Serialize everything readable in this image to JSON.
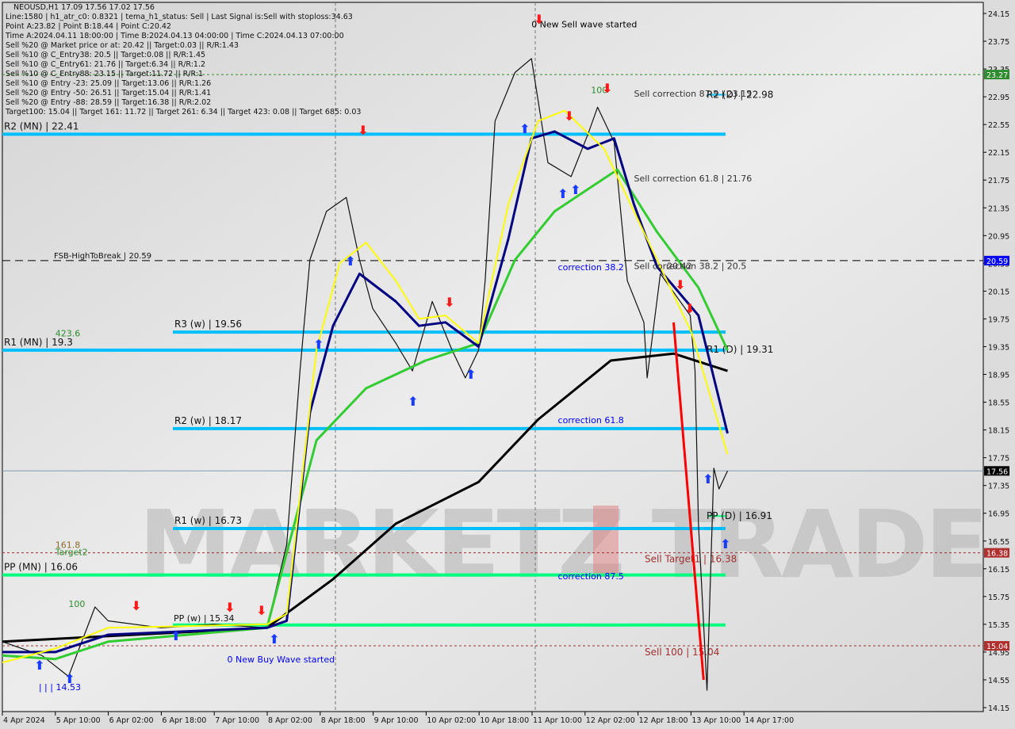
{
  "header": {
    "symbol_line": "NEOUSD,H1  17.09 17.56 17.02 17.56",
    "info_lines": [
      "Line:1580 | h1_atr_c0: 0.8321 | tema_h1_status: Sell | Last Signal is:Sell with stoploss:34.63",
      "Point A:23.82 | Point B:18.44 | Point C:20.42",
      "Time A:2024.04.11 18:00:00 | Time B:2024.04.13 04:00:00 | Time C:2024.04.13 07:00:00",
      "Sell %20 @ Market price or at: 20.42 || Target:0.03 || R/R:1.43",
      "Sell %10 @ C_Entry38: 20.5 || Target:0.08 || R/R:1.45",
      "Sell %10 @ C_Entry61: 21.76 || Target:6.34 || R/R:1.2",
      "Sell %10 @ C_Entry88: 23.15 || Target:11.72 || R/R:1",
      "Sell %10 @ Entry -23: 25.09 || Target:13.06 || R/R:1.26",
      "Sell %20 @ Entry -50: 26.51 || Target:15.04 || R/R:1.41",
      "Sell %20 @ Entry -88: 28.59 || Target:16.38 || R/R:2.02",
      "Target100: 15.04 || Target 161: 11.72 || Target 261: 6.34 || Target 423: 0.08 || Target 685: 0.03"
    ]
  },
  "watermark": "MARKETZ TRADE",
  "chart_data": {
    "type": "line",
    "title": "NEOUSD,H1",
    "ylim": [
      14.15,
      24.15
    ],
    "y_ticks": [
      "24.15",
      "23.75",
      "23.35",
      "22.95",
      "22.55",
      "22.15",
      "21.75",
      "21.35",
      "20.95",
      "20.55",
      "20.15",
      "19.75",
      "19.35",
      "18.95",
      "18.55",
      "18.15",
      "17.75",
      "17.35",
      "16.95",
      "16.55",
      "16.15",
      "15.75",
      "15.35",
      "14.95",
      "14.55",
      "14.15"
    ],
    "x_ticks": [
      "4 Apr 2024",
      "5 Apr 10:00",
      "6 Apr 02:00",
      "6 Apr 18:00",
      "7 Apr 10:00",
      "8 Apr 02:00",
      "8 Apr 18:00",
      "9 Apr 10:00",
      "10 Apr 02:00",
      "10 Apr 18:00",
      "11 Apr 10:00",
      "12 Apr 02:00",
      "12 Apr 18:00",
      "13 Apr 10:00",
      "14 Apr 17:00"
    ],
    "price_tags": [
      {
        "value": "23.27",
        "color": "#2e8b2e"
      },
      {
        "value": "20.59",
        "color": "#0000ff"
      },
      {
        "value": "17.56",
        "color": "#000000"
      },
      {
        "value": "16.38",
        "color": "#b03030"
      },
      {
        "value": "15.04",
        "color": "#b03030"
      }
    ],
    "series": [
      {
        "color": "#111111",
        "points": [
          [
            "4 Apr 18:00",
            15.1
          ],
          [
            "5 Apr 06:00",
            14.9
          ],
          [
            "5 Apr 14:00",
            14.6
          ],
          [
            "5 Apr 22:00",
            15.6
          ],
          [
            "6 Apr 02:00",
            15.4
          ],
          [
            "6 Apr 18:00",
            15.3
          ],
          [
            "7 Apr 10:00",
            15.35
          ],
          [
            "8 Apr 02:00",
            15.3
          ],
          [
            "8 Apr 08:00",
            16.5
          ],
          [
            "8 Apr 12:00",
            19.0
          ],
          [
            "8 Apr 15:00",
            20.6
          ],
          [
            "8 Apr 20:00",
            21.3
          ],
          [
            "9 Apr 02:00",
            21.5
          ],
          [
            "9 Apr 06:00",
            20.6
          ],
          [
            "9 Apr 10:00",
            19.9
          ],
          [
            "9 Apr 17:00",
            19.4
          ],
          [
            "9 Apr 22:00",
            19.0
          ],
          [
            "10 Apr 04:00",
            20.0
          ],
          [
            "10 Apr 10:00",
            19.3
          ],
          [
            "10 Apr 14:00",
            18.9
          ],
          [
            "10 Apr 18:00",
            19.3
          ],
          [
            "10 Apr 20:00",
            20.3
          ],
          [
            "10 Apr 23:00",
            22.6
          ],
          [
            "11 Apr 05:00",
            23.3
          ],
          [
            "11 Apr 10:00",
            23.5
          ],
          [
            "11 Apr 15:00",
            22.0
          ],
          [
            "11 Apr 22:00",
            21.8
          ],
          [
            "12 Apr 03:00",
            22.4
          ],
          [
            "12 Apr 06:00",
            22.8
          ],
          [
            "12 Apr 11:00",
            22.3
          ],
          [
            "12 Apr 15:00",
            20.3
          ],
          [
            "12 Apr 20:00",
            19.7
          ],
          [
            "12 Apr 21:00",
            18.9
          ],
          [
            "13 Apr 01:00",
            20.4
          ],
          [
            "13 Apr 10:00",
            19.8
          ],
          [
            "13 Apr 13:00",
            19.0
          ],
          [
            "13 Apr 15:00",
            16.8
          ],
          [
            "13 Apr 20:00",
            14.4
          ],
          [
            "14 Apr 00:00",
            17.6
          ],
          [
            "14 Apr 03:00",
            17.3
          ],
          [
            "14 Apr 08:00",
            17.56
          ]
        ]
      },
      {
        "color": "#000000",
        "points": [
          [
            "4 Apr 18:00",
            15.1
          ],
          [
            "8 Apr 02:00",
            15.3
          ],
          [
            "8 Apr 22:00",
            16.0
          ],
          [
            "9 Apr 17:00",
            16.8
          ],
          [
            "10 Apr 18:00",
            17.4
          ],
          [
            "11 Apr 12:00",
            18.3
          ],
          [
            "12 Apr 10:00",
            19.15
          ],
          [
            "13 Apr 05:00",
            19.25
          ],
          [
            "14 Apr 08:00",
            19.0
          ]
        ]
      },
      {
        "color": "#33cc33",
        "points": [
          [
            "4 Apr 18:00",
            14.9
          ],
          [
            "5 Apr 10:00",
            14.85
          ],
          [
            "6 Apr 02:00",
            15.1
          ],
          [
            "8 Apr 02:00",
            15.3
          ],
          [
            "8 Apr 17:00",
            18.0
          ],
          [
            "9 Apr 08:00",
            18.75
          ],
          [
            "10 Apr 02:00",
            19.15
          ],
          [
            "10 Apr 18:00",
            19.4
          ],
          [
            "11 Apr 05:00",
            20.6
          ],
          [
            "11 Apr 17:00",
            21.3
          ],
          [
            "12 Apr 12:00",
            21.9
          ],
          [
            "13 Apr 00:00",
            21.0
          ],
          [
            "13 Apr 15:00",
            20.2
          ],
          [
            "14 Apr 08:00",
            19.3
          ]
        ]
      },
      {
        "color": "#000080",
        "points": [
          [
            "4 Apr 18:00",
            14.95
          ],
          [
            "5 Apr 10:00",
            14.95
          ],
          [
            "6 Apr 02:00",
            15.2
          ],
          [
            "8 Apr 02:00",
            15.3
          ],
          [
            "8 Apr 08:00",
            15.4
          ],
          [
            "8 Apr 15:00",
            18.4
          ],
          [
            "8 Apr 22:00",
            19.65
          ],
          [
            "9 Apr 06:00",
            20.4
          ],
          [
            "9 Apr 17:00",
            20.0
          ],
          [
            "10 Apr 00:00",
            19.65
          ],
          [
            "10 Apr 08:00",
            19.7
          ],
          [
            "10 Apr 18:00",
            19.35
          ],
          [
            "11 Apr 03:00",
            20.9
          ],
          [
            "11 Apr 10:00",
            22.35
          ],
          [
            "11 Apr 17:00",
            22.45
          ],
          [
            "12 Apr 03:00",
            22.2
          ],
          [
            "12 Apr 11:00",
            22.35
          ],
          [
            "12 Apr 17:00",
            21.4
          ],
          [
            "13 Apr 00:00",
            20.5
          ],
          [
            "13 Apr 15:00",
            19.8
          ],
          [
            "14 Apr 08:00",
            18.1
          ]
        ]
      },
      {
        "color": "#ffff00",
        "points": [
          [
            "4 Apr 18:00",
            14.8
          ],
          [
            "5 Apr 10:00",
            15.0
          ],
          [
            "6 Apr 02:00",
            15.3
          ],
          [
            "8 Apr 02:00",
            15.35
          ],
          [
            "8 Apr 08:00",
            15.5
          ],
          [
            "8 Apr 17:00",
            19.3
          ],
          [
            "9 Apr 00:00",
            20.55
          ],
          [
            "9 Apr 08:00",
            20.85
          ],
          [
            "9 Apr 17:00",
            20.3
          ],
          [
            "10 Apr 00:00",
            19.75
          ],
          [
            "10 Apr 08:00",
            19.8
          ],
          [
            "10 Apr 18:00",
            19.4
          ],
          [
            "11 Apr 03:00",
            21.4
          ],
          [
            "11 Apr 12:00",
            22.6
          ],
          [
            "11 Apr 20:00",
            22.75
          ],
          [
            "12 Apr 08:00",
            22.2
          ],
          [
            "12 Apr 12:00",
            21.8
          ],
          [
            "12 Apr 22:00",
            20.8
          ],
          [
            "13 Apr 11:00",
            19.55
          ],
          [
            "14 Apr 08:00",
            17.8
          ]
        ]
      }
    ],
    "trend_line": {
      "color": "#ff0000",
      "from": [
        "13 Apr 05:00",
        19.7
      ],
      "to": [
        "13 Apr 18:00",
        14.55
      ]
    },
    "levels": [
      {
        "value": 22.41,
        "label": "R2 (MN) | 22.41",
        "color": "#00bfff",
        "style": "thick",
        "span": "full"
      },
      {
        "value": 19.3,
        "label": "R1 (MN) | 19.3",
        "color": "#00bfff",
        "style": "thick",
        "span": "full"
      },
      {
        "value": 19.56,
        "label": "R3 (w) | 19.56",
        "color": "#00bfff",
        "style": "thick",
        "span": "week"
      },
      {
        "value": 18.17,
        "label": "R2 (w) | 18.17",
        "color": "#00bfff",
        "style": "thick",
        "span": "week"
      },
      {
        "value": 16.73,
        "label": "R1 (w) | 16.73",
        "color": "#00bfff",
        "style": "thick",
        "span": "week"
      },
      {
        "value": 16.06,
        "label": "PP (MN) | 16.06",
        "color": "#00ff7f",
        "style": "thick",
        "span": "full"
      },
      {
        "value": 15.34,
        "label": "PP (w) | 15.34",
        "color": "#00ff7f",
        "style": "thick",
        "span": "week"
      },
      {
        "value": 22.98,
        "label": "R2 (D) | 22.98",
        "color": "#00bfff",
        "style": "short",
        "span": "day"
      },
      {
        "value": 19.31,
        "label": "R1 (D) | 19.31",
        "color": "#00bfff",
        "style": "none",
        "span": "day"
      },
      {
        "value": 16.91,
        "label": "PP (D) | 16.91",
        "color": "#00ff7f",
        "style": "short",
        "span": "day"
      },
      {
        "value": 23.27,
        "label": "",
        "color": "#2e8b2e",
        "style": "dotted",
        "span": "all"
      },
      {
        "value": 20.59,
        "label": "FSB-HighToBreak | 20.59",
        "color": "#000000",
        "style": "dashed",
        "span": "all"
      },
      {
        "value": 16.38,
        "label": "Sell Target1 | 16.38",
        "color": "#a03030",
        "style": "dotted",
        "span": "all"
      },
      {
        "value": 15.04,
        "label": "Sell 100 | 15.04",
        "color": "#a03030",
        "style": "dotted",
        "span": "all"
      },
      {
        "value": 17.56,
        "label": "",
        "color": "#8a9aa8",
        "style": "thin",
        "span": "all"
      }
    ],
    "annotations": [
      {
        "text": "0 New Sell wave started",
        "color": "#000000",
        "at": [
          "11 Apr 10:00",
          23.95
        ]
      },
      {
        "text": "Sell correction 87.5 | 23.15",
        "color": "#333333",
        "at": [
          "12 Apr 17:00",
          22.95
        ]
      },
      {
        "text": "Sell correction 61.8 | 21.76",
        "color": "#333333",
        "at": [
          "12 Apr 17:00",
          21.73
        ]
      },
      {
        "text": "Sell correction 38.2 | 20.5",
        "color": "#333333",
        "at": [
          "12 Apr 17:00",
          20.47
        ]
      },
      {
        "text": "20.42",
        "color": "#333333",
        "at": [
          "13 Apr 03:00",
          20.47
        ]
      },
      {
        "text": "correction 38.2",
        "color": "#0000ff",
        "at": [
          "11 Apr 18:00",
          20.45
        ]
      },
      {
        "text": "correction 61.8",
        "color": "#0000ff",
        "at": [
          "11 Apr 18:00",
          18.25
        ]
      },
      {
        "text": "correction 87.5",
        "color": "#0000ff",
        "at": [
          "11 Apr 18:00",
          16.0
        ]
      },
      {
        "text": "100",
        "color": "#2e8b2e",
        "at": [
          "12 Apr 04:00",
          23.0
        ]
      },
      {
        "text": "100",
        "color": "#2e8b2e",
        "at": [
          "5 Apr 14:00",
          15.6
        ]
      },
      {
        "text": "423.6",
        "color": "#2e8b2e",
        "at": [
          "5 Apr 10:00",
          19.5
        ]
      },
      {
        "text": "161.8",
        "color": "#8a6a2a",
        "at": [
          "5 Apr 10:00",
          16.45
        ]
      },
      {
        "text": "Target2",
        "color": "#2e8b2e",
        "at": [
          "5 Apr 10:00",
          16.35
        ]
      },
      {
        "text": "0 New Buy Wave started",
        "color": "#0000ff",
        "at": [
          "7 Apr 14:00",
          14.8
        ]
      },
      {
        "text": "| | | 14.53",
        "color": "#0000ff",
        "at": [
          "4 Apr 29:00",
          14.4
        ]
      }
    ]
  }
}
